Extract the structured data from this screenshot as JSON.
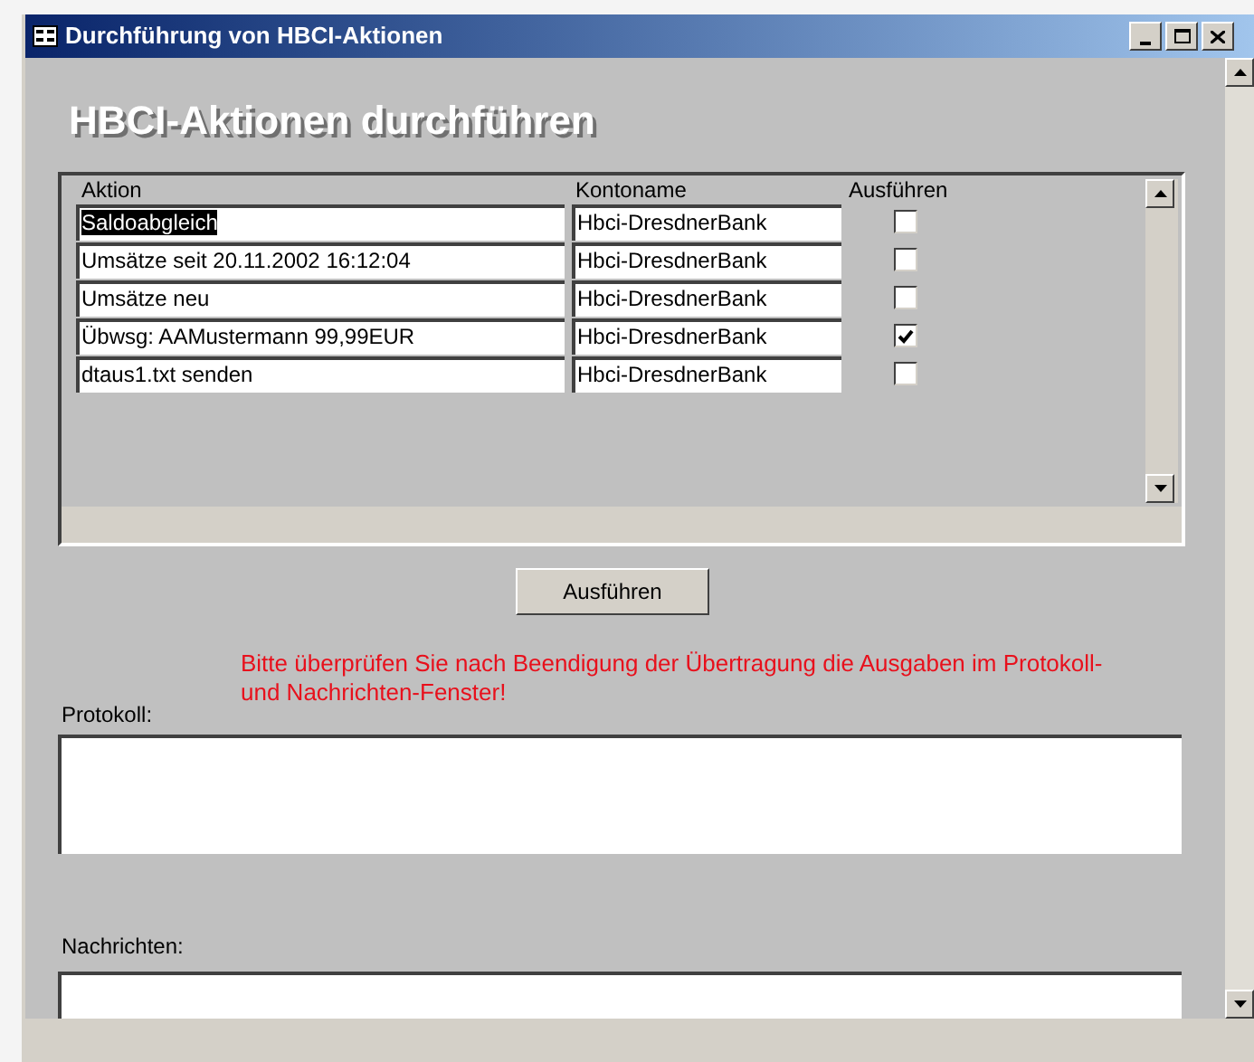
{
  "window": {
    "title": "Durchführung von HBCI-Aktionen"
  },
  "heading": "HBCI-Aktionen durchführen",
  "table": {
    "columns": [
      "Aktion",
      "Kontoname",
      "Ausführen"
    ],
    "rows": [
      {
        "aktion": "Saldoabgleich",
        "konto": "Hbci-DresdnerBank",
        "checked": false,
        "selected": true
      },
      {
        "aktion": "Umsätze seit 20.11.2002 16:12:04",
        "konto": "Hbci-DresdnerBank",
        "checked": false,
        "selected": false
      },
      {
        "aktion": "Umsätze neu",
        "konto": "Hbci-DresdnerBank",
        "checked": false,
        "selected": false
      },
      {
        "aktion": "Übwsg: AAMustermann 99,99EUR",
        "konto": "Hbci-DresdnerBank",
        "checked": true,
        "selected": false
      },
      {
        "aktion": "dtaus1.txt senden",
        "konto": "Hbci-DresdnerBank",
        "checked": false,
        "selected": false
      }
    ]
  },
  "run_button": "Ausführen",
  "warning": "Bitte überprüfen Sie nach Beendigung der Übertragung die Ausgaben im Protokoll- und Nachrichten-Fenster!",
  "protokoll_label": "Protokoll:",
  "nachrichten_label": "Nachrichten:"
}
